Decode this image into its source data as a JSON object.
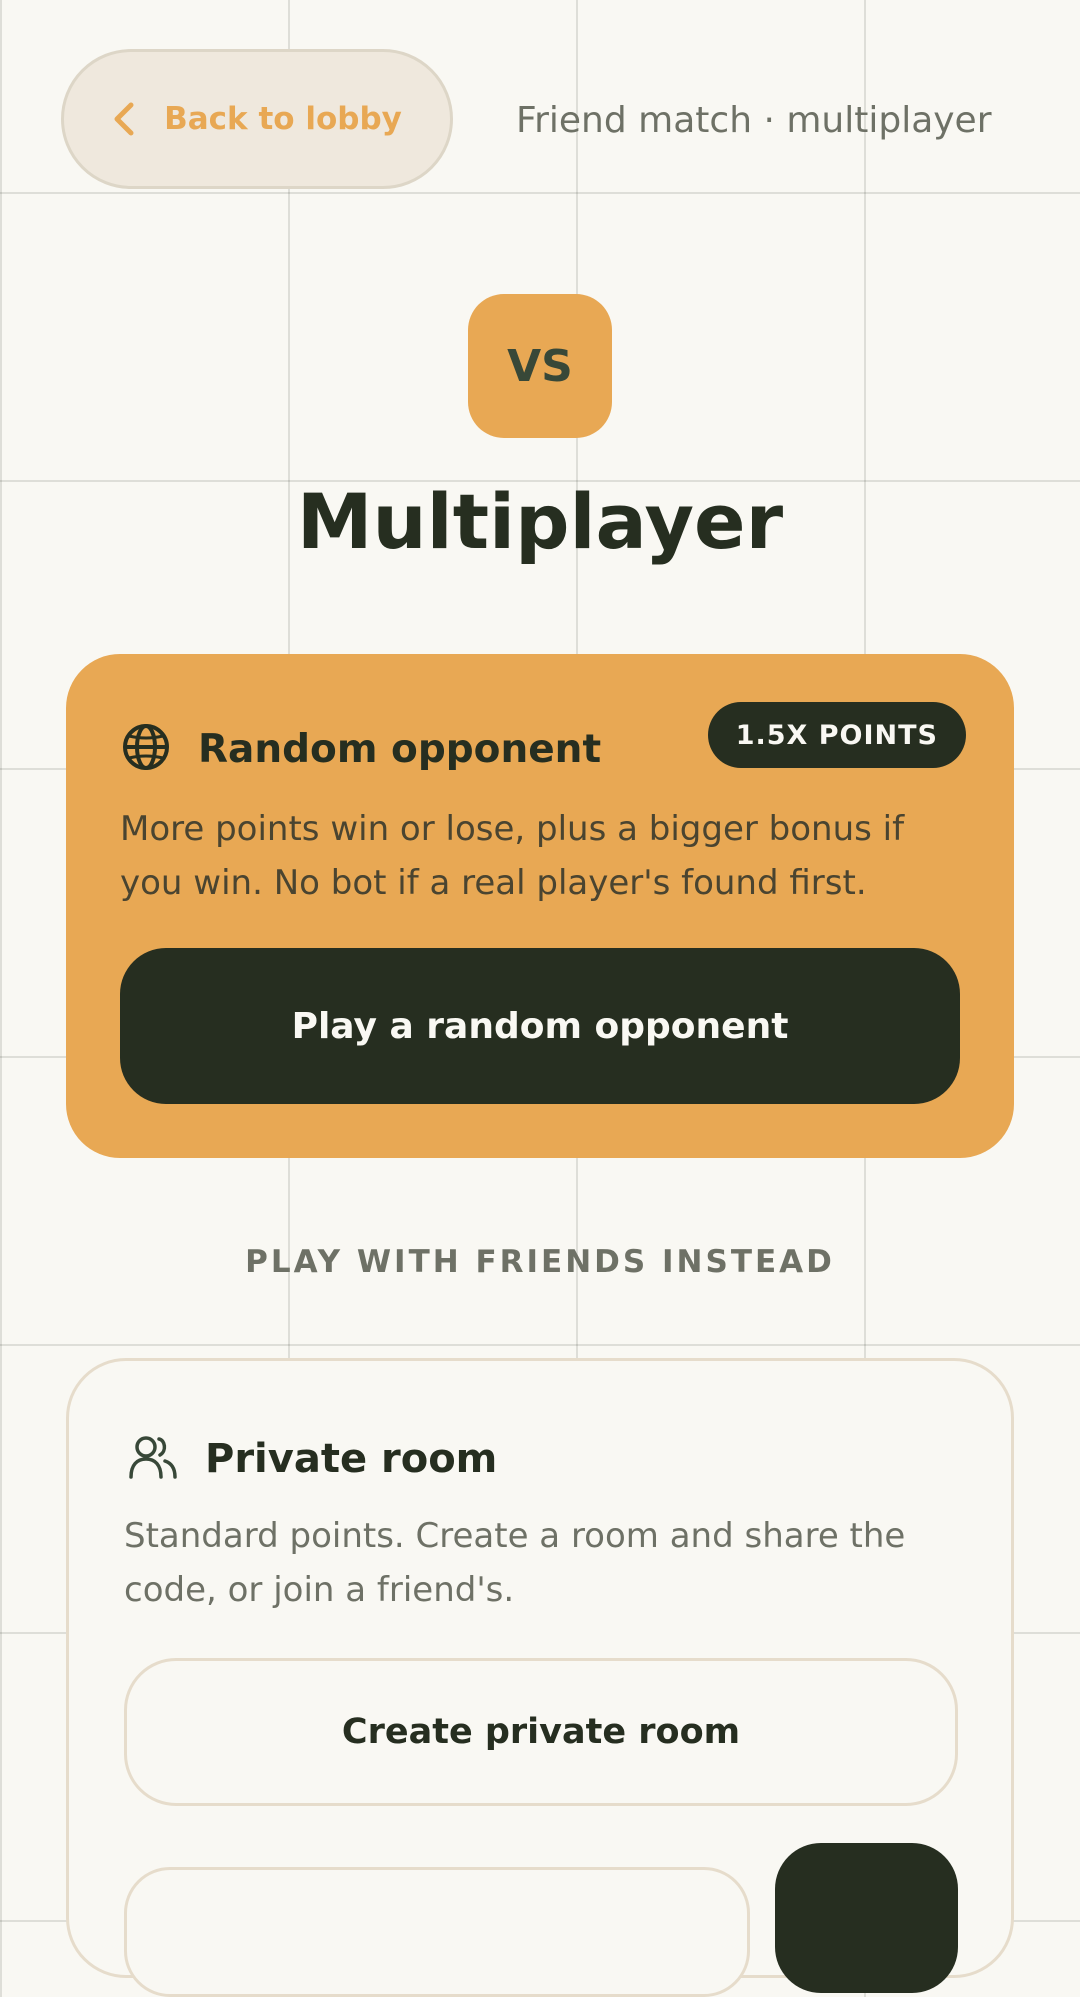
{
  "header": {
    "back_label": "Back to lobby",
    "mode_label": "Friend match · multiplayer"
  },
  "hero": {
    "badge_text": "VS",
    "title": "Multiplayer"
  },
  "random_card": {
    "title": "Random opponent",
    "badge": "1.5X POINTS",
    "description": "More points win or lose, plus a bigger bonus if you win. No bot if a real player's found first.",
    "button_label": "Play a random opponent",
    "icon": "globe-icon"
  },
  "divider_text": "PLAY WITH FRIENDS INSTEAD",
  "private_card": {
    "title": "Private room",
    "description": "Standard points. Create a room and share the code, or join a friend's.",
    "create_label": "Create private room",
    "icon": "users-icon",
    "code_input_value": ""
  },
  "colors": {
    "background": "#f9f8f3",
    "accent": "#e8a854",
    "dark": "#262e20",
    "muted": "#6e7166",
    "border": "#e6dccb"
  }
}
